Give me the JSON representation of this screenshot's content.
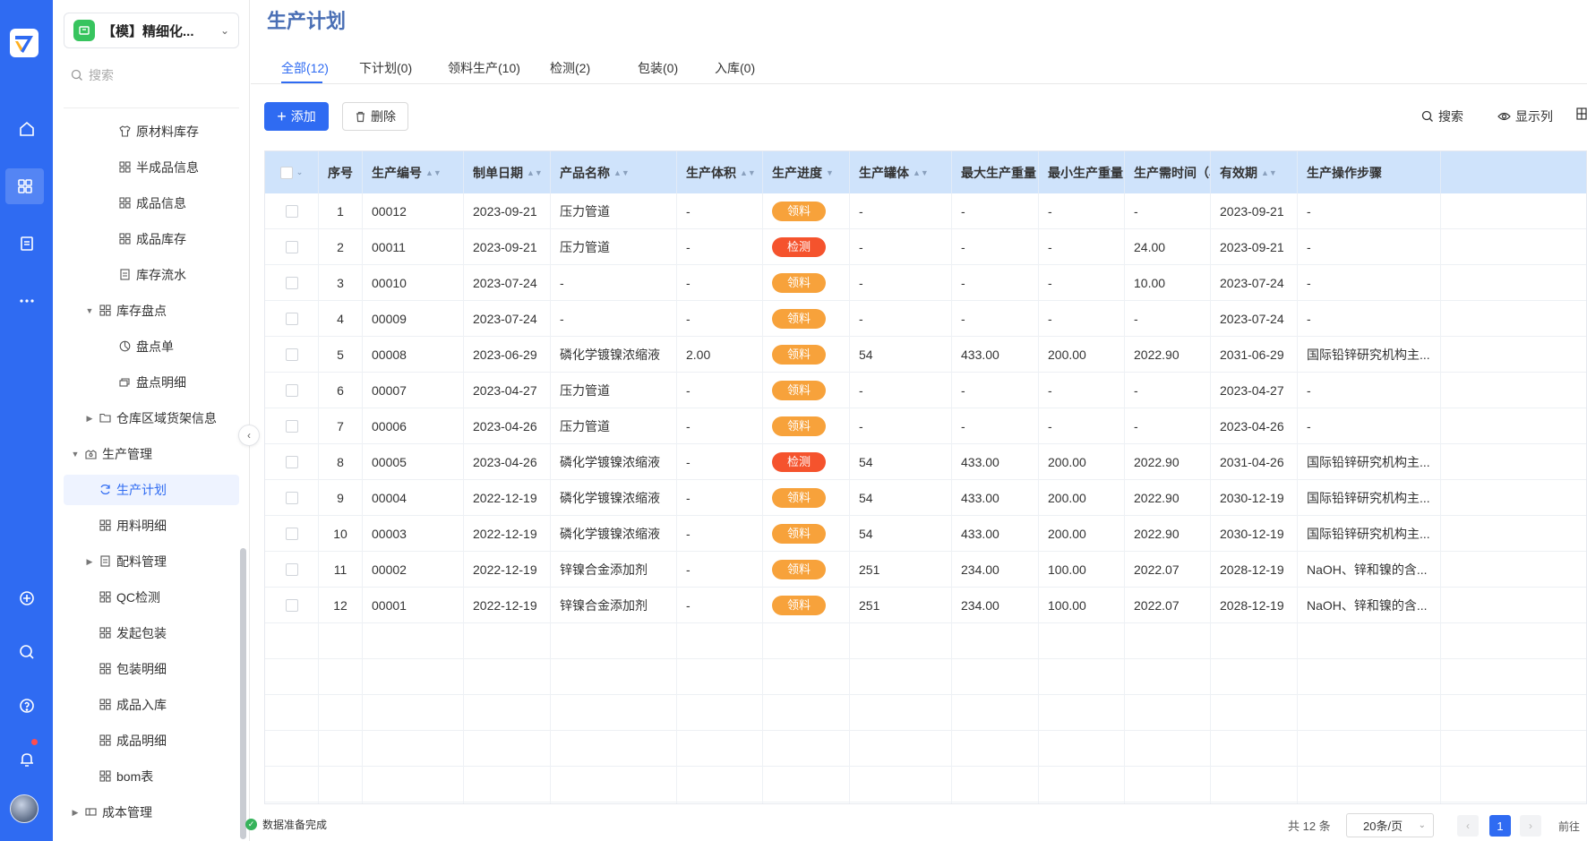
{
  "app": {
    "name": "【模】精细化...",
    "search_placeholder": "搜索"
  },
  "sidebar": {
    "items": [
      {
        "label": "原材料库存",
        "icon": "shirt-icon",
        "level": 2
      },
      {
        "label": "半成品信息",
        "icon": "grid-icon",
        "level": 2
      },
      {
        "label": "成品信息",
        "icon": "grid-icon",
        "level": 2
      },
      {
        "label": "成品库存",
        "icon": "grid-icon",
        "level": 2
      },
      {
        "label": "库存流水",
        "icon": "document-icon",
        "level": 2
      },
      {
        "label": "库存盘点",
        "icon": "grid-icon",
        "level": 1,
        "caret": "expanded"
      },
      {
        "label": "盘点单",
        "icon": "chart-pie-icon",
        "level": 2
      },
      {
        "label": "盘点明细",
        "icon": "stack-icon",
        "level": 2
      },
      {
        "label": "仓库区域货架信息",
        "icon": "folder-icon",
        "level": 1,
        "caret": "collapsed"
      },
      {
        "label": "生产管理",
        "icon": "factory-icon",
        "level": 0,
        "caret": "expanded"
      },
      {
        "label": "生产计划",
        "icon": "refresh-icon",
        "level": 1,
        "active": true
      },
      {
        "label": "用料明细",
        "icon": "grid-icon",
        "level": 1
      },
      {
        "label": "配料管理",
        "icon": "document-icon",
        "level": 1,
        "caret": "collapsed"
      },
      {
        "label": "QC检测",
        "icon": "grid-icon",
        "level": 1
      },
      {
        "label": "发起包装",
        "icon": "grid-icon",
        "level": 1
      },
      {
        "label": "包装明细",
        "icon": "grid-icon",
        "level": 1
      },
      {
        "label": "成品入库",
        "icon": "grid-icon",
        "level": 1
      },
      {
        "label": "成品明细",
        "icon": "grid-icon",
        "level": 1
      },
      {
        "label": "bom表",
        "icon": "grid-icon",
        "level": 1
      },
      {
        "label": "成本管理",
        "icon": "ticket-icon",
        "level": 0,
        "caret": "collapsed"
      }
    ]
  },
  "page": {
    "title": "生产计划",
    "tabs": [
      "全部(12)",
      "下计划(0)",
      "领料生产(10)",
      "检测(2)",
      "包装(0)",
      "入库(0)"
    ],
    "active_tab": 0
  },
  "toolbar": {
    "add_label": "添加",
    "delete_label": "删除",
    "search_label": "搜索",
    "columns_label": "显示列"
  },
  "table": {
    "columns": [
      "序号",
      "生产编号",
      "制单日期",
      "产品名称",
      "生产体积",
      "生产进度",
      "生产罐体",
      "最大生产重量",
      "最小生产重量",
      "生产需时间（小",
      "有效期",
      "生产操作步骤"
    ],
    "rows": [
      {
        "no": "1",
        "code": "00012",
        "date": "2023-09-21",
        "product": "压力管道",
        "volume": "-",
        "progress": "领料",
        "tank": "-",
        "max_w": "-",
        "min_w": "-",
        "hours": "-",
        "expiry": "2023-09-21",
        "steps": "-"
      },
      {
        "no": "2",
        "code": "00011",
        "date": "2023-09-21",
        "product": "压力管道",
        "volume": "-",
        "progress": "检测",
        "tank": "-",
        "max_w": "-",
        "min_w": "-",
        "hours": "24.00",
        "expiry": "2023-09-21",
        "steps": "-"
      },
      {
        "no": "3",
        "code": "00010",
        "date": "2023-07-24",
        "product": "-",
        "volume": "-",
        "progress": "领料",
        "tank": "-",
        "max_w": "-",
        "min_w": "-",
        "hours": "10.00",
        "expiry": "2023-07-24",
        "steps": "-"
      },
      {
        "no": "4",
        "code": "00009",
        "date": "2023-07-24",
        "product": "-",
        "volume": "-",
        "progress": "领料",
        "tank": "-",
        "max_w": "-",
        "min_w": "-",
        "hours": "-",
        "expiry": "2023-07-24",
        "steps": "-"
      },
      {
        "no": "5",
        "code": "00008",
        "date": "2023-06-29",
        "product": "磷化学镀镍浓缩液",
        "volume": "2.00",
        "progress": "领料",
        "tank": "54",
        "max_w": "433.00",
        "min_w": "200.00",
        "hours": "2022.90",
        "expiry": "2031-06-29",
        "steps": "国际铅锌研究机构主..."
      },
      {
        "no": "6",
        "code": "00007",
        "date": "2023-04-27",
        "product": "压力管道",
        "volume": "-",
        "progress": "领料",
        "tank": "-",
        "max_w": "-",
        "min_w": "-",
        "hours": "-",
        "expiry": "2023-04-27",
        "steps": "-"
      },
      {
        "no": "7",
        "code": "00006",
        "date": "2023-04-26",
        "product": "压力管道",
        "volume": "-",
        "progress": "领料",
        "tank": "-",
        "max_w": "-",
        "min_w": "-",
        "hours": "-",
        "expiry": "2023-04-26",
        "steps": "-"
      },
      {
        "no": "8",
        "code": "00005",
        "date": "2023-04-26",
        "product": "磷化学镀镍浓缩液",
        "volume": "-",
        "progress": "检测",
        "tank": "54",
        "max_w": "433.00",
        "min_w": "200.00",
        "hours": "2022.90",
        "expiry": "2031-04-26",
        "steps": "国际铅锌研究机构主..."
      },
      {
        "no": "9",
        "code": "00004",
        "date": "2022-12-19",
        "product": "磷化学镀镍浓缩液",
        "volume": "-",
        "progress": "领料",
        "tank": "54",
        "max_w": "433.00",
        "min_w": "200.00",
        "hours": "2022.90",
        "expiry": "2030-12-19",
        "steps": "国际铅锌研究机构主..."
      },
      {
        "no": "10",
        "code": "00003",
        "date": "2022-12-19",
        "product": "磷化学镀镍浓缩液",
        "volume": "-",
        "progress": "领料",
        "tank": "54",
        "max_w": "433.00",
        "min_w": "200.00",
        "hours": "2022.90",
        "expiry": "2030-12-19",
        "steps": "国际铅锌研究机构主..."
      },
      {
        "no": "11",
        "code": "00002",
        "date": "2022-12-19",
        "product": "锌镍合金添加剂",
        "volume": "-",
        "progress": "领料",
        "tank": "251",
        "max_w": "234.00",
        "min_w": "100.00",
        "hours": "2022.07",
        "expiry": "2028-12-19",
        "steps": "NaOH、锌和镍的含..."
      },
      {
        "no": "12",
        "code": "00001",
        "date": "2022-12-19",
        "product": "锌镍合金添加剂",
        "volume": "-",
        "progress": "领料",
        "tank": "251",
        "max_w": "234.00",
        "min_w": "100.00",
        "hours": "2022.07",
        "expiry": "2028-12-19",
        "steps": "NaOH、锌和镍的含..."
      }
    ],
    "progress_colors": {
      "领料": "#f7a23b",
      "检测": "#f5532d"
    }
  },
  "footer": {
    "status": "数据准备完成",
    "total": "共 12 条",
    "page_size": "20条/页",
    "current_page": "1",
    "goto_label": "前往"
  },
  "colors": {
    "accent": "#2f6bf2",
    "header_bg": "#cfe3fb",
    "title": "#4a6fb5"
  }
}
